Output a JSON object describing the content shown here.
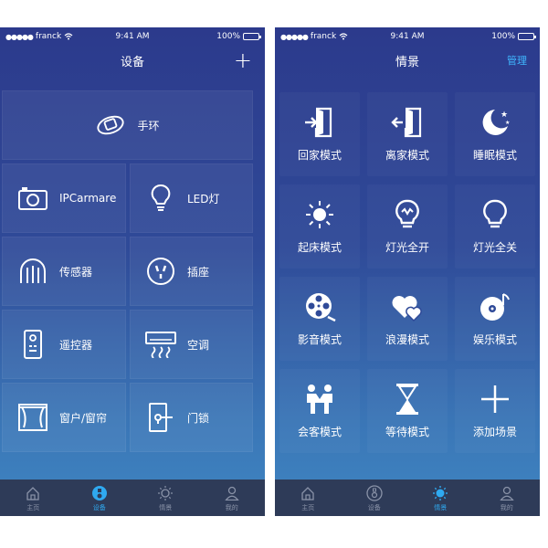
{
  "status_bar": {
    "carrier": "franck",
    "time": "9:41 AM",
    "battery": "100%"
  },
  "left": {
    "title": "设备",
    "devices": [
      {
        "label": "手环",
        "icon": "bracelet-icon"
      },
      {
        "label": "IPCarmare",
        "icon": "camera-icon"
      },
      {
        "label": "LED灯",
        "icon": "bulb-icon"
      },
      {
        "label": "传感器",
        "icon": "sensor-icon"
      },
      {
        "label": "插座",
        "icon": "socket-icon"
      },
      {
        "label": "遥控器",
        "icon": "remote-icon"
      },
      {
        "label": "空调",
        "icon": "air-conditioner-icon"
      },
      {
        "label": "窗户/窗帘",
        "icon": "curtain-icon"
      },
      {
        "label": "门锁",
        "icon": "door-lock-icon"
      }
    ],
    "tabs": [
      {
        "label": "主页",
        "icon": "home-icon",
        "active": false
      },
      {
        "label": "设备",
        "icon": "device-icon",
        "active": true
      },
      {
        "label": "情景",
        "icon": "sun-icon",
        "active": false
      },
      {
        "label": "我的",
        "icon": "user-icon",
        "active": false
      }
    ]
  },
  "right": {
    "title": "情景",
    "manage_label": "管理",
    "scenes": [
      {
        "label": "回家模式",
        "icon": "enter-home-icon"
      },
      {
        "label": "离家模式",
        "icon": "leave-home-icon"
      },
      {
        "label": "睡眠模式",
        "icon": "moon-stars-icon"
      },
      {
        "label": "起床模式",
        "icon": "sunrise-icon"
      },
      {
        "label": "灯光全开",
        "icon": "light-on-icon"
      },
      {
        "label": "灯光全关",
        "icon": "light-off-icon"
      },
      {
        "label": "影音模式",
        "icon": "film-reel-icon"
      },
      {
        "label": "浪漫模式",
        "icon": "hearts-icon"
      },
      {
        "label": "娱乐模式",
        "icon": "music-disc-icon"
      },
      {
        "label": "会客模式",
        "icon": "guests-icon"
      },
      {
        "label": "等待模式",
        "icon": "hourglass-icon"
      },
      {
        "label": "添加场景",
        "icon": "add-icon"
      }
    ],
    "tabs": [
      {
        "label": "主页",
        "icon": "home-icon",
        "active": false
      },
      {
        "label": "设备",
        "icon": "device-icon",
        "active": false
      },
      {
        "label": "情景",
        "icon": "sun-icon",
        "active": true
      },
      {
        "label": "我的",
        "icon": "user-icon",
        "active": false
      }
    ]
  },
  "colors": {
    "accent": "#2fa9f0",
    "manage": "#3fb7ff",
    "tabbar": "#2e3b58"
  }
}
